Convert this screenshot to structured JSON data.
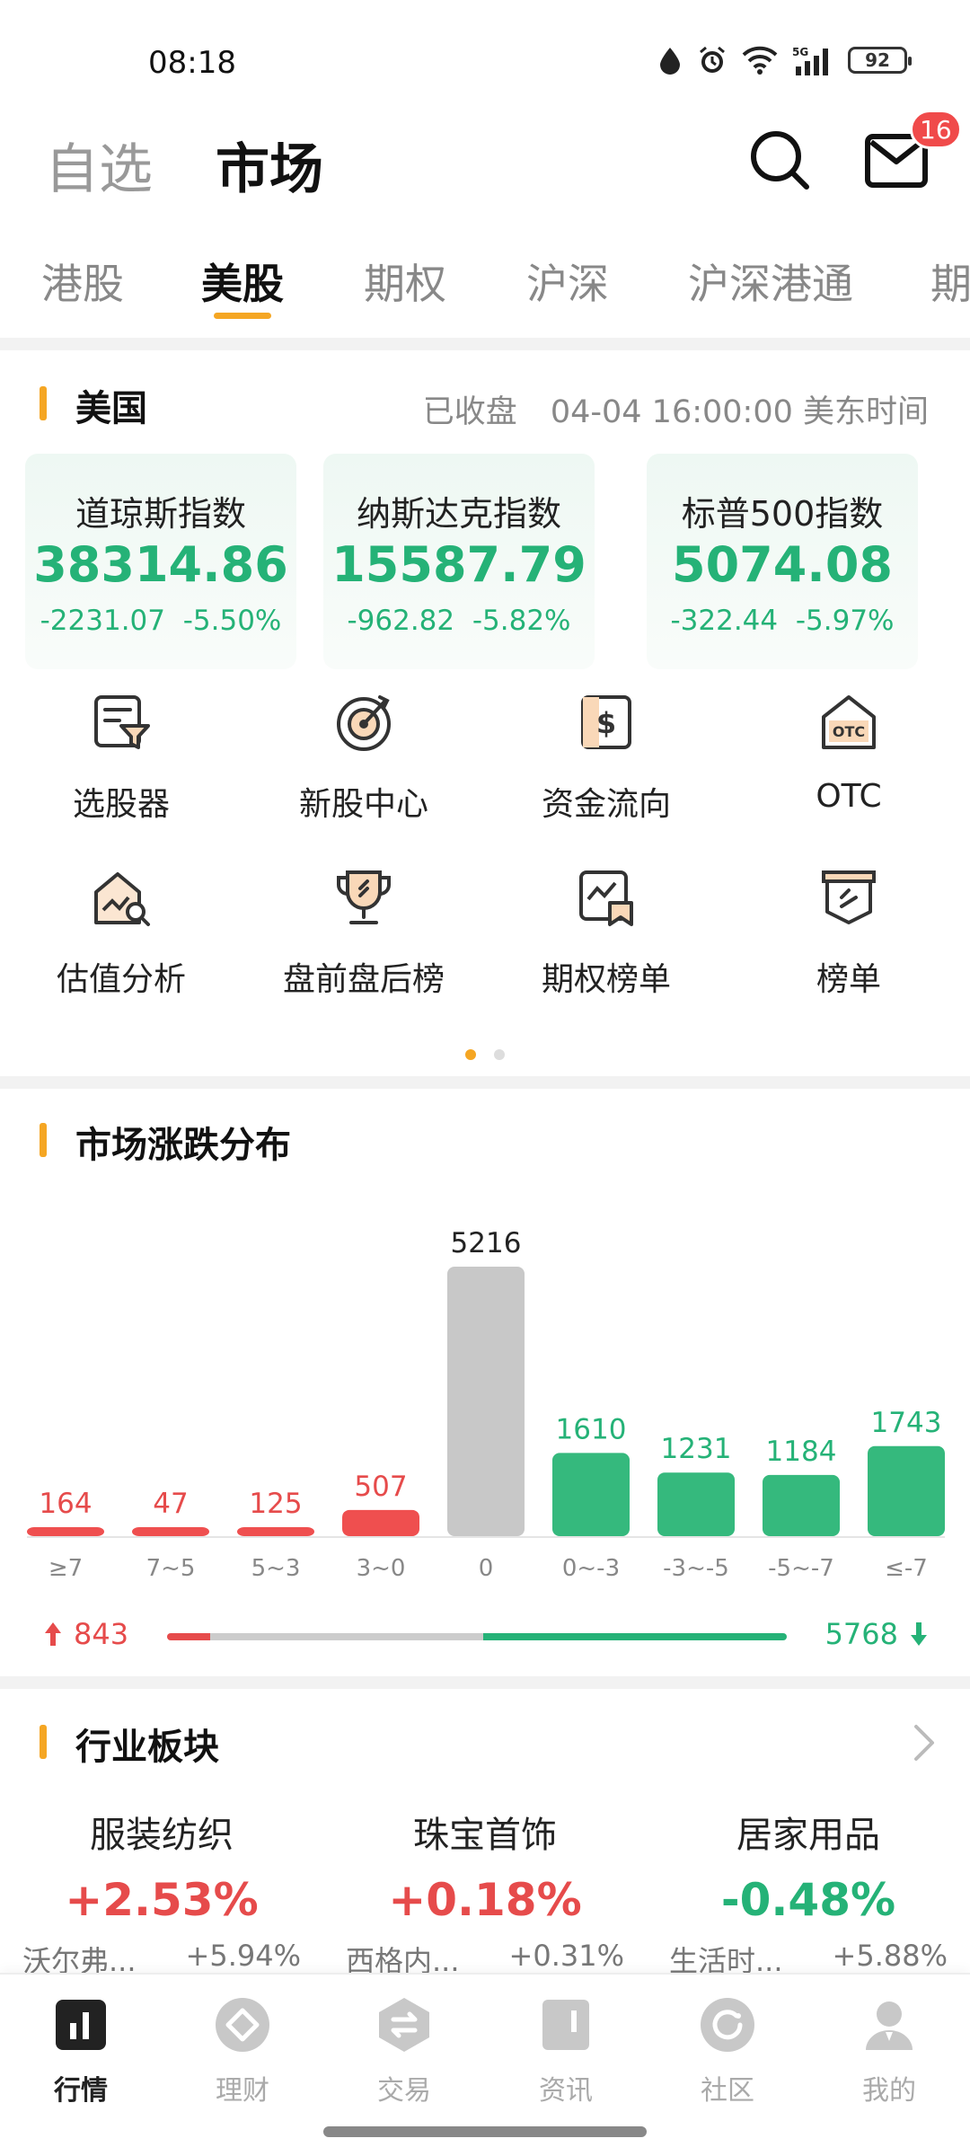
{
  "status_bar": {
    "time": "08:18",
    "battery": "92"
  },
  "header": {
    "tab_watchlist": "自选",
    "tab_market": "市场",
    "mail_badge": "16"
  },
  "sub_tabs": [
    "港股",
    "美股",
    "期权",
    "沪深",
    "沪深港通",
    "期"
  ],
  "us_section": {
    "title": "美国",
    "status": "已收盘",
    "datetime": "04-04 16:00:00 美东时间",
    "indices": [
      {
        "name": "道琼斯指数",
        "value": "38314.86",
        "change": "-2231.07",
        "pct": "-5.50%"
      },
      {
        "name": "纳斯达克指数",
        "value": "15587.79",
        "change": "-962.82",
        "pct": "-5.82%"
      },
      {
        "name": "标普500指数",
        "value": "5074.08",
        "change": "-322.44",
        "pct": "-5.97%"
      }
    ]
  },
  "tools": [
    {
      "label": "选股器",
      "icon": "stock-screener-icon"
    },
    {
      "label": "新股中心",
      "icon": "ipo-center-icon"
    },
    {
      "label": "资金流向",
      "icon": "money-flow-icon"
    },
    {
      "label": "OTC",
      "icon": "otc-icon"
    },
    {
      "label": "估值分析",
      "icon": "valuation-icon"
    },
    {
      "label": "盘前盘后榜",
      "icon": "pre-post-market-icon"
    },
    {
      "label": "期权榜单",
      "icon": "options-ranking-icon"
    },
    {
      "label": "榜单",
      "icon": "ranking-icon"
    }
  ],
  "distribution": {
    "title": "市场涨跌分布",
    "up_total": "843",
    "down_total": "5768"
  },
  "chart_data": {
    "type": "bar",
    "categories": [
      "≥7",
      "7~5",
      "5~3",
      "3~0",
      "0",
      "0~-3",
      "-3~-5",
      "-5~-7",
      "≤-7"
    ],
    "values": [
      164,
      47,
      125,
      507,
      5216,
      1610,
      1231,
      1184,
      1743
    ],
    "colors": [
      "#ef4f4f",
      "#ef4f4f",
      "#ef4f4f",
      "#ef4f4f",
      "#c8c8c8",
      "#35b97d",
      "#35b97d",
      "#35b97d",
      "#35b97d"
    ]
  },
  "industry": {
    "title": "行业板块",
    "items": [
      {
        "name": "服装纺织",
        "change": "+2.53%",
        "stock": "沃尔弗...",
        "stock_change": "+5.94%",
        "color": "#e64b4b"
      },
      {
        "name": "珠宝首饰",
        "change": "+0.18%",
        "stock": "西格内...",
        "stock_change": "+0.31%",
        "color": "#e64b4b"
      },
      {
        "name": "居家用品",
        "change": "-0.48%",
        "stock": "生活时...",
        "stock_change": "+5.88%",
        "color": "#25b277"
      }
    ]
  },
  "bottom_nav": [
    {
      "label": "行情",
      "icon": "market-icon",
      "active": true
    },
    {
      "label": "理财",
      "icon": "wealth-icon",
      "active": false
    },
    {
      "label": "交易",
      "icon": "trade-icon",
      "active": false
    },
    {
      "label": "资讯",
      "icon": "news-icon",
      "active": false
    },
    {
      "label": "社区",
      "icon": "community-icon",
      "active": false
    },
    {
      "label": "我的",
      "icon": "profile-icon",
      "active": false
    }
  ]
}
